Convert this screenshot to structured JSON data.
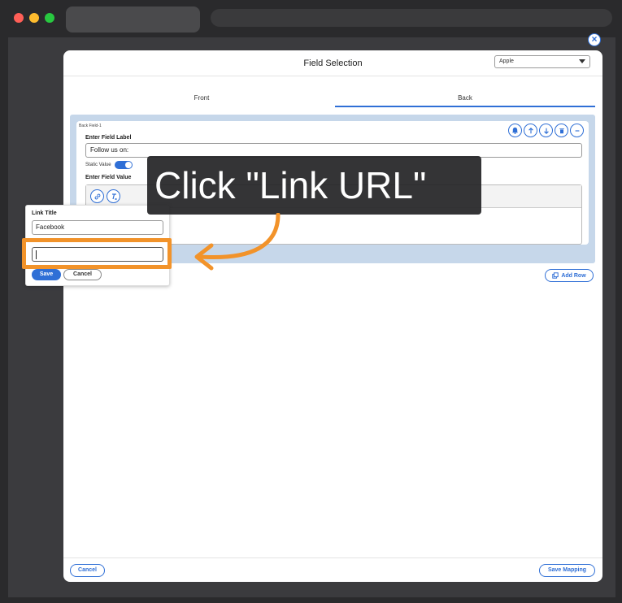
{
  "colors": {
    "accent": "#2f6fd6",
    "highlight": "#f2932a",
    "panel": "#c6d7ea"
  },
  "modal": {
    "title": "Field Selection",
    "brand_select": "Apple",
    "tabs": {
      "front": "Front",
      "back": "Back"
    },
    "card": {
      "title": "Back Field-1",
      "icons": [
        "bell-icon",
        "arrow-up-icon",
        "arrow-down-icon",
        "trash-icon",
        "minus-icon"
      ],
      "field_label_heading": "Enter Field Label",
      "field_label_value": "Follow us on:",
      "static_value_label": "Static Value",
      "field_value_heading": "Enter Field Value",
      "toolbar_icons": [
        "link-icon",
        "clear-format-icon"
      ]
    },
    "add_row_label": "Add Row",
    "cancel_label": "Cancel",
    "save_mapping_label": "Save Mapping"
  },
  "popover": {
    "link_title_label": "Link Title",
    "link_title_value": "Facebook",
    "link_url_value": "",
    "save_label": "Save",
    "cancel_label": "Cancel"
  },
  "annotation": {
    "callout_text": "Click \"Link URL\""
  }
}
